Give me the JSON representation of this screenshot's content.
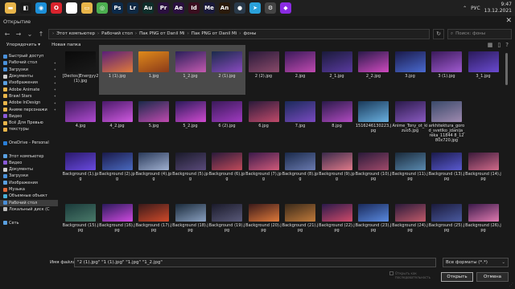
{
  "taskbar": {
    "apps": [
      {
        "icon": "folder-icon",
        "glyph": "▬",
        "color": "#e8b54a"
      },
      {
        "icon": "windows-store-icon",
        "glyph": "◧",
        "color": "#1a1a1a"
      },
      {
        "icon": "edge-icon",
        "glyph": "◉",
        "color": "#1c8fd8"
      },
      {
        "icon": "opera-icon",
        "glyph": "O",
        "color": "#d9232d"
      },
      {
        "icon": "yandex-icon",
        "glyph": "Y",
        "color": "#ffffff"
      },
      {
        "icon": "explorer-icon",
        "glyph": "▭",
        "color": "#e8b54a"
      },
      {
        "icon": "chrome-icon",
        "glyph": "◎",
        "color": "#4caf50"
      },
      {
        "icon": "photoshop-icon",
        "glyph": "Ps",
        "color": "#0b2a4a"
      },
      {
        "icon": "lightroom-icon",
        "glyph": "Lr",
        "color": "#0f2a44"
      },
      {
        "icon": "audition-icon",
        "glyph": "Au",
        "color": "#0e2e2a"
      },
      {
        "icon": "premiere-icon",
        "glyph": "Pr",
        "color": "#2a0f3f"
      },
      {
        "icon": "after-effects-icon",
        "glyph": "Ae",
        "color": "#2a0f3f"
      },
      {
        "icon": "illustrator-icon",
        "glyph": "Id",
        "color": "#3a0d1f"
      },
      {
        "icon": "media-encoder-icon",
        "glyph": "Me",
        "color": "#1a1a3a"
      },
      {
        "icon": "animate-icon",
        "glyph": "An",
        "color": "#2a1a0a"
      },
      {
        "icon": "steam-icon",
        "glyph": "●",
        "color": "#2a3a4a"
      },
      {
        "icon": "telegram-icon",
        "glyph": "➤",
        "color": "#2aa1da"
      },
      {
        "icon": "settings-icon",
        "glyph": "⚙",
        "color": "#444444"
      },
      {
        "icon": "app-icon",
        "glyph": "◆",
        "color": "#8a2be2"
      }
    ],
    "tray": {
      "lang": "РУС",
      "time": "9:47",
      "date": "13.12.2021"
    }
  },
  "dialog": {
    "title": "Открытие",
    "breadcrumbs": [
      "Этот компьютер",
      "Рабочий стол",
      "Пак PNG от Danil Mi",
      "Пак PNG от Danil Mi",
      "фоны"
    ],
    "search_placeholder": "Поиск: фоны",
    "toolbar": {
      "organize": "Упорядочить ▾",
      "new_folder": "Новая папка"
    }
  },
  "sidebar": {
    "items": [
      {
        "label": "Быстрый доступ",
        "color": "#4a90d9",
        "pin": false,
        "sel": false
      },
      {
        "label": "Рабочий стол",
        "color": "#4a90d9",
        "pin": true,
        "sel": false
      },
      {
        "label": "Загрузки",
        "color": "#4a90d9",
        "pin": true,
        "sel": false
      },
      {
        "label": "Документы",
        "color": "#cfcfcf",
        "pin": true,
        "sel": false
      },
      {
        "label": "Изображения",
        "color": "#5aa0e0",
        "pin": true,
        "sel": false
      },
      {
        "label": "Adobe Animate",
        "color": "#e8b54a",
        "pin": true,
        "sel": false
      },
      {
        "label": "Brawl Stars",
        "color": "#e8b54a",
        "pin": true,
        "sel": false
      },
      {
        "label": "Adobe InDesign",
        "color": "#e8b54a",
        "pin": true,
        "sel": false
      },
      {
        "label": "Аниме персонажи",
        "color": "#e8b54a",
        "pin": true,
        "sel": false
      },
      {
        "label": "Видео",
        "color": "#8a5ad9",
        "pin": false,
        "sel": false
      },
      {
        "label": "Всё Для Превью",
        "color": "#e8b54a",
        "pin": false,
        "sel": false
      },
      {
        "label": "текстуры",
        "color": "#e8b54a",
        "pin": false,
        "sel": false
      },
      {
        "label": "",
        "color": "transparent",
        "pin": false,
        "sel": false
      },
      {
        "label": "OneDrive - Personal",
        "color": "#2a7fd8",
        "pin": false,
        "sel": false
      },
      {
        "label": "",
        "color": "transparent",
        "pin": false,
        "sel": false
      },
      {
        "label": "Этот компьютер",
        "color": "#5aa0e0",
        "pin": false,
        "sel": false
      },
      {
        "label": "Видео",
        "color": "#8a5ad9",
        "pin": false,
        "sel": false
      },
      {
        "label": "Документы",
        "color": "#cfcfcf",
        "pin": false,
        "sel": false
      },
      {
        "label": "Загрузки",
        "color": "#4a90d9",
        "pin": false,
        "sel": false
      },
      {
        "label": "Изображения",
        "color": "#5aa0e0",
        "pin": false,
        "sel": false
      },
      {
        "label": "Музыка",
        "color": "#e06a3a",
        "pin": false,
        "sel": false
      },
      {
        "label": "Объемные объект",
        "color": "#4ab0d9",
        "pin": false,
        "sel": false
      },
      {
        "label": "Рабочий стол",
        "color": "#4a90d9",
        "pin": false,
        "sel": true
      },
      {
        "label": "Локальный диск (C",
        "color": "#bdbdbd",
        "pin": false,
        "sel": false
      },
      {
        "label": "",
        "color": "transparent",
        "pin": false,
        "sel": false
      },
      {
        "label": "Сеть",
        "color": "#5aa0e0",
        "pin": false,
        "sel": false
      }
    ]
  },
  "files": {
    "rows": [
      [
        {
          "name": "[Dectos]Energyy2 (1).jpg",
          "sel": false,
          "c1": "#0a0a0a",
          "c2": "#1a1a1a"
        },
        {
          "name": "1 (1).jpg",
          "sel": true,
          "c1": "#5a1f7a",
          "c2": "#e07a3a"
        },
        {
          "name": "1.jpg",
          "sel": true,
          "c1": "#e08a1a",
          "c2": "#8a3a1a"
        },
        {
          "name": "1_2.jpg",
          "sel": true,
          "c1": "#2a1f5a",
          "c2": "#c45ab0"
        },
        {
          "name": "2 (1).jpg",
          "sel": true,
          "c1": "#1a2a4a",
          "c2": "#8a4ac0"
        },
        {
          "name": "2 (2).jpg",
          "sel": false,
          "c1": "#2a1a3a",
          "c2": "#8a4a6a"
        },
        {
          "name": "2.jpg",
          "sel": false,
          "c1": "#3a1a5a",
          "c2": "#c04ab0"
        },
        {
          "name": "2_1.jpg",
          "sel": false,
          "c1": "#1a1a3a",
          "c2": "#5a3aa0"
        },
        {
          "name": "2_2.jpg",
          "sel": false,
          "c1": "#2a1a4a",
          "c2": "#d04ac0"
        },
        {
          "name": "3.jpg",
          "sel": false,
          "c1": "#1a1a4a",
          "c2": "#4a6ad0"
        },
        {
          "name": "3 (1).jpg",
          "sel": false,
          "c1": "#3a1a5a",
          "c2": "#a05ad0"
        },
        {
          "name": "3_1.jpg",
          "sel": false,
          "c1": "#2a1a5a",
          "c2": "#6a4ad0"
        }
      ],
      [
        {
          "name": "4.jpg",
          "sel": false,
          "c1": "#3a1a5a",
          "c2": "#b04ad0"
        },
        {
          "name": "4_2.jpg",
          "sel": false,
          "c1": "#4a1a6a",
          "c2": "#d05ae0"
        },
        {
          "name": "5.jpg",
          "sel": false,
          "c1": "#1a2a4a",
          "c2": "#c04ab0"
        },
        {
          "name": "5_2.jpg",
          "sel": false,
          "c1": "#2a1a5a",
          "c2": "#d04ad0"
        },
        {
          "name": "6 (2).jpg",
          "sel": false,
          "c1": "#3a1a5a",
          "c2": "#a03ac0"
        },
        {
          "name": "6.jpg",
          "sel": false,
          "c1": "#2a1a3a",
          "c2": "#c04a6a"
        },
        {
          "name": "7.jpg",
          "sel": false,
          "c1": "#1a2a5a",
          "c2": "#7a4ac0"
        },
        {
          "name": "8.jpg",
          "sel": false,
          "c1": "#2a1a4a",
          "c2": "#b04ac0"
        },
        {
          "name": "1516246130223.jpg",
          "sel": false,
          "c1": "#1a3a5a",
          "c2": "#6ab0e0"
        },
        {
          "name": "Anime_Tony_ot_kizuo5.jpg",
          "sel": false,
          "c1": "#2a1a4a",
          "c2": "#8a5ac0"
        },
        {
          "name": "arkhitektura_gorod_svetlko_jdanija_reka_11844 8_1280x720.jpg",
          "sel": false,
          "c1": "#3a4a6a",
          "c2": "#a08ab0"
        }
      ],
      [
        {
          "name": "Background (1).jpg",
          "sel": false,
          "c1": "#2a1a6a",
          "c2": "#6a4ae0"
        },
        {
          "name": "Background (2).jpg",
          "sel": false,
          "c1": "#1a1a4a",
          "c2": "#4a6ac0"
        },
        {
          "name": "Background (4).jpg",
          "sel": false,
          "c1": "#2a3a5a",
          "c2": "#a0b0d0"
        },
        {
          "name": "Background (5).jpg",
          "sel": false,
          "c1": "#1a1a2a",
          "c2": "#5a4a7a"
        },
        {
          "name": "Background (6).jpg",
          "sel": false,
          "c1": "#2a1a3a",
          "c2": "#c04a5a"
        },
        {
          "name": "Background (7).jpg",
          "sel": false,
          "c1": "#3a1a4a",
          "c2": "#d05a7a"
        },
        {
          "name": "Background (8).jpg",
          "sel": false,
          "c1": "#1a2a4a",
          "c2": "#6a7ab0"
        },
        {
          "name": "Background (9).jpg",
          "sel": false,
          "c1": "#3a2a4a",
          "c2": "#e07a8a"
        },
        {
          "name": "Background (10).jpg",
          "sel": false,
          "c1": "#2a1a3a",
          "c2": "#a04a6a"
        },
        {
          "name": "Background (11).jpg",
          "sel": false,
          "c1": "#1a2a3a",
          "c2": "#5a8ab0"
        },
        {
          "name": "Background (13).jpg",
          "sel": false,
          "c1": "#1a1a4a",
          "c2": "#5a5ad0"
        },
        {
          "name": "Background (14).jpg",
          "sel": false,
          "c1": "#3a1a3a",
          "c2": "#d06a8a"
        }
      ],
      [
        {
          "name": "Background (15).jpg",
          "sel": false,
          "c1": "#1a3a3a",
          "c2": "#4a7a6a"
        },
        {
          "name": "Background (16).jpg",
          "sel": false,
          "c1": "#2a1a5a",
          "c2": "#d04ae0"
        },
        {
          "name": "Background (17).jpg",
          "sel": false,
          "c1": "#3a1a1a",
          "c2": "#d04a2a"
        },
        {
          "name": "Background (18).jpg",
          "sel": false,
          "c1": "#1a2a3a",
          "c2": "#8aa0c0"
        },
        {
          "name": "Background (19).jpg",
          "sel": false,
          "c1": "#1a1a2a",
          "c2": "#5a5a7a"
        },
        {
          "name": "Background (20).jpg",
          "sel": false,
          "c1": "#3a1a1a",
          "c2": "#e07a3a"
        },
        {
          "name": "Background (21).jpg",
          "sel": false,
          "c1": "#3a2a1a",
          "c2": "#c07a3a"
        },
        {
          "name": "Background (22).jpg",
          "sel": false,
          "c1": "#2a1a4a",
          "c2": "#d04a6a"
        },
        {
          "name": "Background (23).jpg",
          "sel": false,
          "c1": "#1a2a5a",
          "c2": "#5a8ae0"
        },
        {
          "name": "Background (24).jpg",
          "sel": false,
          "c1": "#2a1a3a",
          "c2": "#c05a6a"
        },
        {
          "name": "Background (25).jpg",
          "sel": false,
          "c1": "#1a1a3a",
          "c2": "#4a5aa0"
        },
        {
          "name": "Background (26).jpg",
          "sel": false,
          "c1": "#3a1a4a",
          "c2": "#e07ab0"
        }
      ]
    ]
  },
  "footer": {
    "filename_label": "Имя файла:",
    "filename_value": "\"2 (1).jpg\" \"1 (1).jpg\" \"1.jpg\" \"1_2.jpg\"",
    "filetype": "Все форматы (*.*)",
    "checkbox_label": "Открыть как последовательность",
    "open_label": "Открыть",
    "cancel_label": "Отмена"
  }
}
